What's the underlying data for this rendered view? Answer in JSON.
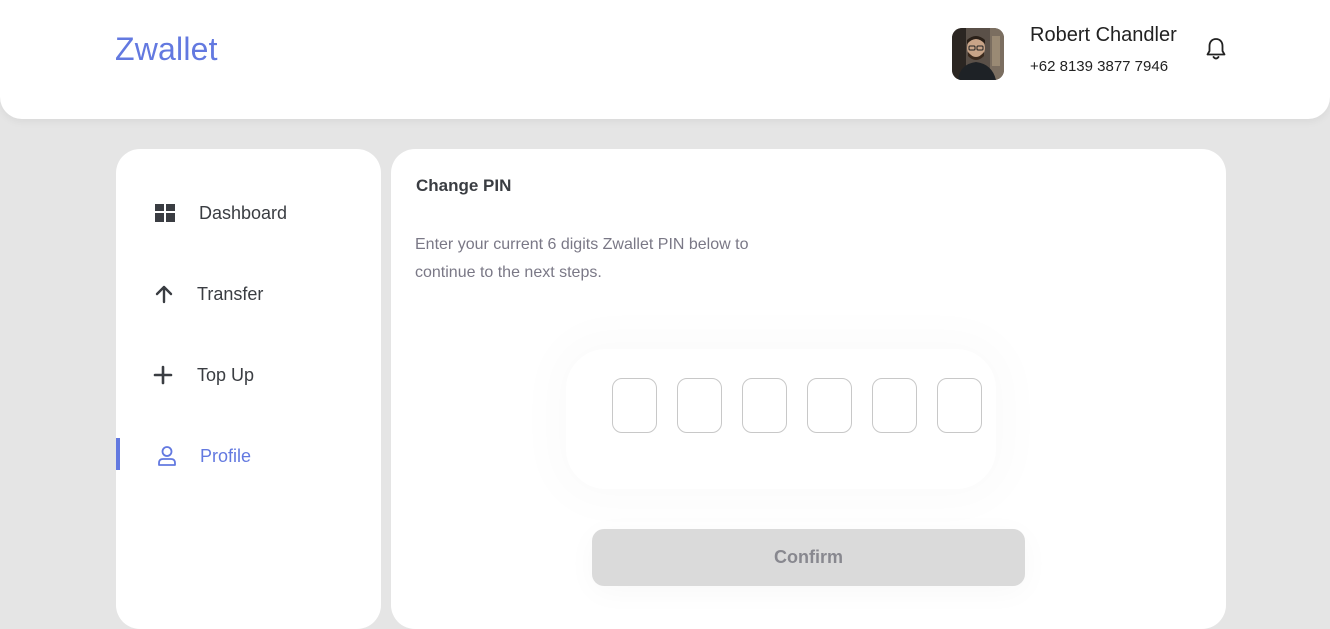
{
  "header": {
    "brand": "Zwallet",
    "user_name": "Robert Chandler",
    "user_phone": "+62 8139 3877 7946"
  },
  "sidebar": {
    "items": [
      {
        "label": "Dashboard",
        "icon": "grid-icon",
        "active": false
      },
      {
        "label": "Transfer",
        "icon": "arrow-up-icon",
        "active": false
      },
      {
        "label": "Top Up",
        "icon": "plus-icon",
        "active": false
      },
      {
        "label": "Profile",
        "icon": "user-icon",
        "active": true
      }
    ]
  },
  "main": {
    "title": "Change PIN",
    "description": "Enter your current 6 digits Zwallet PIN below to continue to the next steps.",
    "pin_values": [
      "",
      "",
      "",
      "",
      "",
      ""
    ],
    "confirm_label": "Confirm"
  },
  "colors": {
    "accent": "#6379e0",
    "background": "#e5e5e5",
    "disabled_button": "#dadada"
  }
}
